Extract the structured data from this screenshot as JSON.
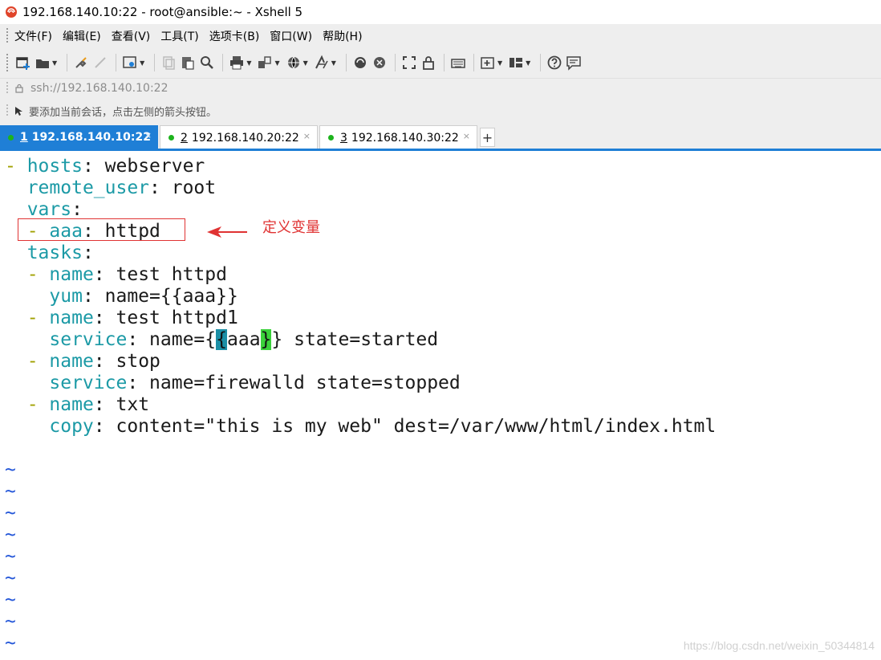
{
  "window": {
    "title": "192.168.140.10:22 - root@ansible:~ - Xshell 5",
    "app_icon": "xshell-logo-icon"
  },
  "menu": {
    "items": [
      "文件(F)",
      "编辑(E)",
      "查看(V)",
      "工具(T)",
      "选项卡(B)",
      "窗口(W)",
      "帮助(H)"
    ]
  },
  "toolbar": {
    "icons": [
      "new-session-icon",
      "open-folder-icon",
      "connect-icon",
      "disconnect-icon",
      "properties-icon",
      "copy-icon",
      "paste-icon",
      "find-icon",
      "print-icon",
      "transfer-icon",
      "globe-icon",
      "font-icon",
      "xftp-icon",
      "xshell-icon",
      "fullscreen-icon",
      "lock-icon",
      "keyboard-icon",
      "add-tab-icon",
      "layout-icon",
      "help-icon",
      "chat-icon"
    ]
  },
  "address": {
    "value": "ssh://192.168.140.10:22",
    "icon": "lock-icon"
  },
  "hint": {
    "text": "要添加当前会话，点击左侧的箭头按钮。",
    "icon": "arrow-icon"
  },
  "tabs": [
    {
      "number": "1",
      "label": "192.168.140.10:22",
      "active": true
    },
    {
      "number": "2",
      "label": "192.168.140.20:22",
      "active": false
    },
    {
      "number": "3",
      "label": "192.168.140.30:22",
      "active": false
    }
  ],
  "tab_add_label": "+",
  "tab_close_glyph": "×",
  "terminal": {
    "colors": {
      "key": "#1c9aa6",
      "dash": "#a0a000",
      "tilde": "#2255d8"
    },
    "lines": [
      {
        "dash": "- ",
        "indent": "",
        "key": "hosts",
        "value": " webserver"
      },
      {
        "dash": "",
        "indent": "  ",
        "key": "remote_user",
        "value": " root"
      },
      {
        "dash": "",
        "indent": "  ",
        "key": "vars",
        "value": ""
      },
      {
        "dash": "- ",
        "indent": "  ",
        "key": "aaa",
        "value": " httpd"
      },
      {
        "dash": "",
        "indent": "  ",
        "key": "tasks",
        "value": ""
      },
      {
        "dash": "- ",
        "indent": "  ",
        "key": "name",
        "value": " test httpd"
      },
      {
        "dash": "",
        "indent": "    ",
        "key": "yum",
        "value": " name={{aaa}}"
      },
      {
        "dash": "- ",
        "indent": "  ",
        "key": "name",
        "value": " test httpd1"
      },
      {
        "dash": "",
        "indent": "    ",
        "key": "service",
        "value": " name={{aaa}} state=started"
      },
      {
        "dash": "- ",
        "indent": "  ",
        "key": "name",
        "value": " stop"
      },
      {
        "dash": "",
        "indent": "    ",
        "key": "service",
        "value": " name=firewalld state=stopped"
      },
      {
        "dash": "- ",
        "indent": "  ",
        "key": "name",
        "value": " txt"
      },
      {
        "dash": "",
        "indent": "    ",
        "key": "copy",
        "value": " content=\"this is my web\" dest=/var/www/html/index.html"
      }
    ],
    "service_line": {
      "pre": " name=",
      "brace_open_1": "{",
      "brace_open_2": "{",
      "var": "aaa",
      "brace_close_1": "}",
      "brace_close_2": "}",
      "post": " state=started"
    },
    "tilde": "~"
  },
  "annotation": {
    "text": "定义变量"
  },
  "watermark": "https://blog.csdn.net/weixin_50344814"
}
